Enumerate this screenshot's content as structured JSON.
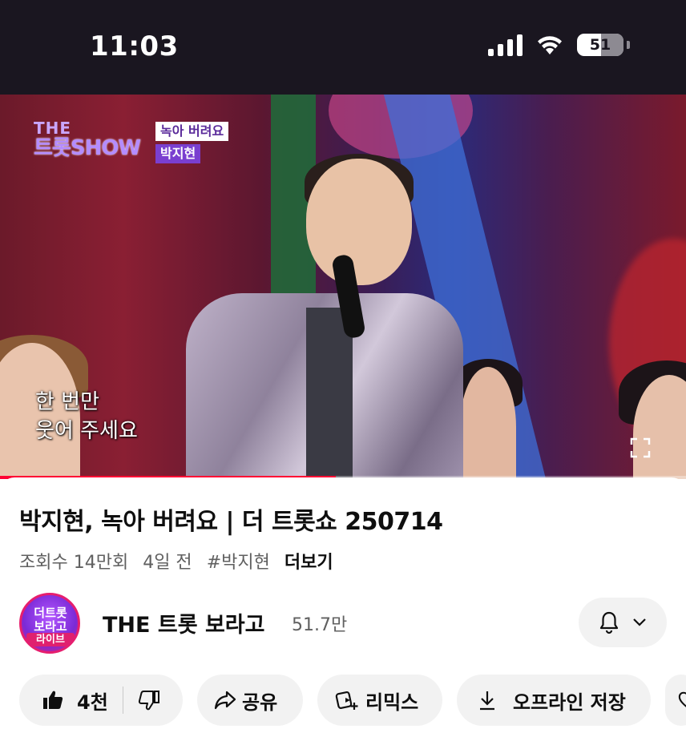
{
  "status_bar": {
    "time": "11:03",
    "battery_level": "51",
    "battery_fraction": 0.51
  },
  "video": {
    "show_logo_the": "THE",
    "show_logo_name": "트롯SHOW",
    "song_title": "녹아 버려요",
    "song_artist": "박지현",
    "subtitle_line1": "한 번만",
    "subtitle_line2": "웃어 주세요",
    "progress_fraction": 0.49
  },
  "info": {
    "title": "박지현, 녹아 버려요 | 더 트롯쇼 250714",
    "views": "조회수 14만회",
    "age": "4일 전",
    "hashtag": "#박지현",
    "more_label": "더보기"
  },
  "channel": {
    "avatar_text": "더트롯 보라고",
    "avatar_badge": "라이브",
    "name": "THE 트롯 보라고",
    "subscribers": "51.7만"
  },
  "actions": {
    "like_count": "4천",
    "share_label": "공유",
    "remix_label": "리믹스",
    "save_label": "오프라인 저장"
  },
  "colors": {
    "status_bar_bg": "#1a1620",
    "progress": "#ff0033",
    "pill_bg": "#f2f2f2",
    "meta_text": "#606060"
  }
}
